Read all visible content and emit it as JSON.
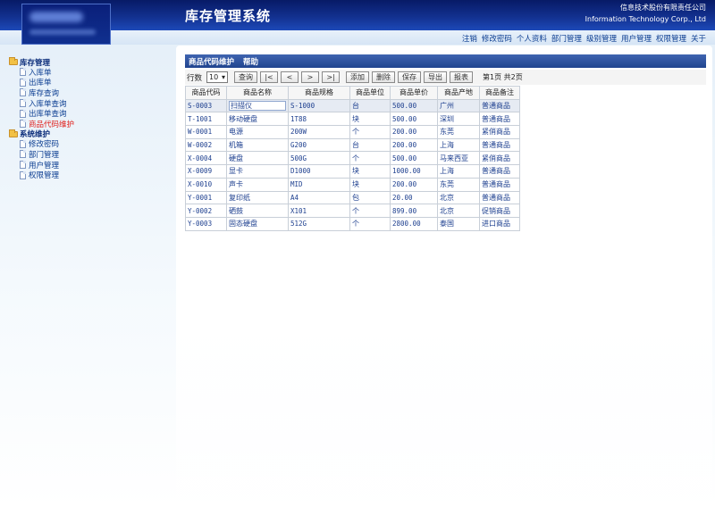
{
  "header": {
    "title": "库存管理系统",
    "company_cn": "信息技术股份有限责任公司",
    "company_en": "Information Technology Corp., Ltd"
  },
  "topnav": [
    "注销",
    "修改密码",
    "个人资料",
    "部门管理",
    "级别管理",
    "用户管理",
    "权限管理",
    "关于"
  ],
  "sidebar": {
    "groups": [
      {
        "label": "库存管理",
        "items": [
          "入库单",
          "出库单",
          "库存查询",
          "入库单查询",
          "出库单查询",
          "商品代码维护"
        ]
      },
      {
        "label": "系统维护",
        "items": [
          "修改密码",
          "部门管理",
          "用户管理",
          "权限管理"
        ]
      }
    ]
  },
  "tabs": [
    "商品代码维护",
    "帮助"
  ],
  "toolbar": {
    "rows_label": "行数",
    "rows_value": "10",
    "query": "查询",
    "first": "|<",
    "prev": "<",
    "next": ">",
    "last": ">|",
    "add": "添加",
    "delete": "删除",
    "save": "保存",
    "export": "导出",
    "report": "报表",
    "page_info": "第1页 共2页"
  },
  "table": {
    "columns": [
      "商品代码",
      "商品名称",
      "商品规格",
      "商品单位",
      "商品单价",
      "商品产地",
      "商品备注"
    ],
    "rows": [
      [
        "S-0003",
        "扫描仪",
        "S-1000",
        "台",
        "500.00",
        "广州",
        "普通商品"
      ],
      [
        "T-1001",
        "移动硬盘",
        "1T88",
        "块",
        "500.00",
        "深圳",
        "普通商品"
      ],
      [
        "W-0001",
        "电源",
        "200W",
        "个",
        "200.00",
        "东莞",
        "紧俏商品"
      ],
      [
        "W-0002",
        "机箱",
        "G200",
        "台",
        "200.00",
        "上海",
        "普通商品"
      ],
      [
        "X-0004",
        "硬盘",
        "500G",
        "个",
        "500.00",
        "马来西亚",
        "紧俏商品"
      ],
      [
        "X-0009",
        "显卡",
        "D1000",
        "块",
        "1000.00",
        "上海",
        "普通商品"
      ],
      [
        "X-0010",
        "声卡",
        "MID",
        "块",
        "200.00",
        "东莞",
        "普通商品"
      ],
      [
        "Y-0001",
        "复印纸",
        "A4",
        "包",
        "20.00",
        "北京",
        "普通商品"
      ],
      [
        "Y-0002",
        "硒鼓",
        "X101",
        "个",
        "899.00",
        "北京",
        "促销商品"
      ],
      [
        "Y-0003",
        "固态硬盘",
        "512G",
        "个",
        "2800.00",
        "泰国",
        "进口商品"
      ]
    ]
  },
  "colors": {
    "header_dark": "#071a66",
    "accent_blue": "#20448f",
    "active_red": "#e0221d"
  },
  "icons": [
    "folder-icon",
    "document-icon",
    "chevron-down-icon"
  ]
}
